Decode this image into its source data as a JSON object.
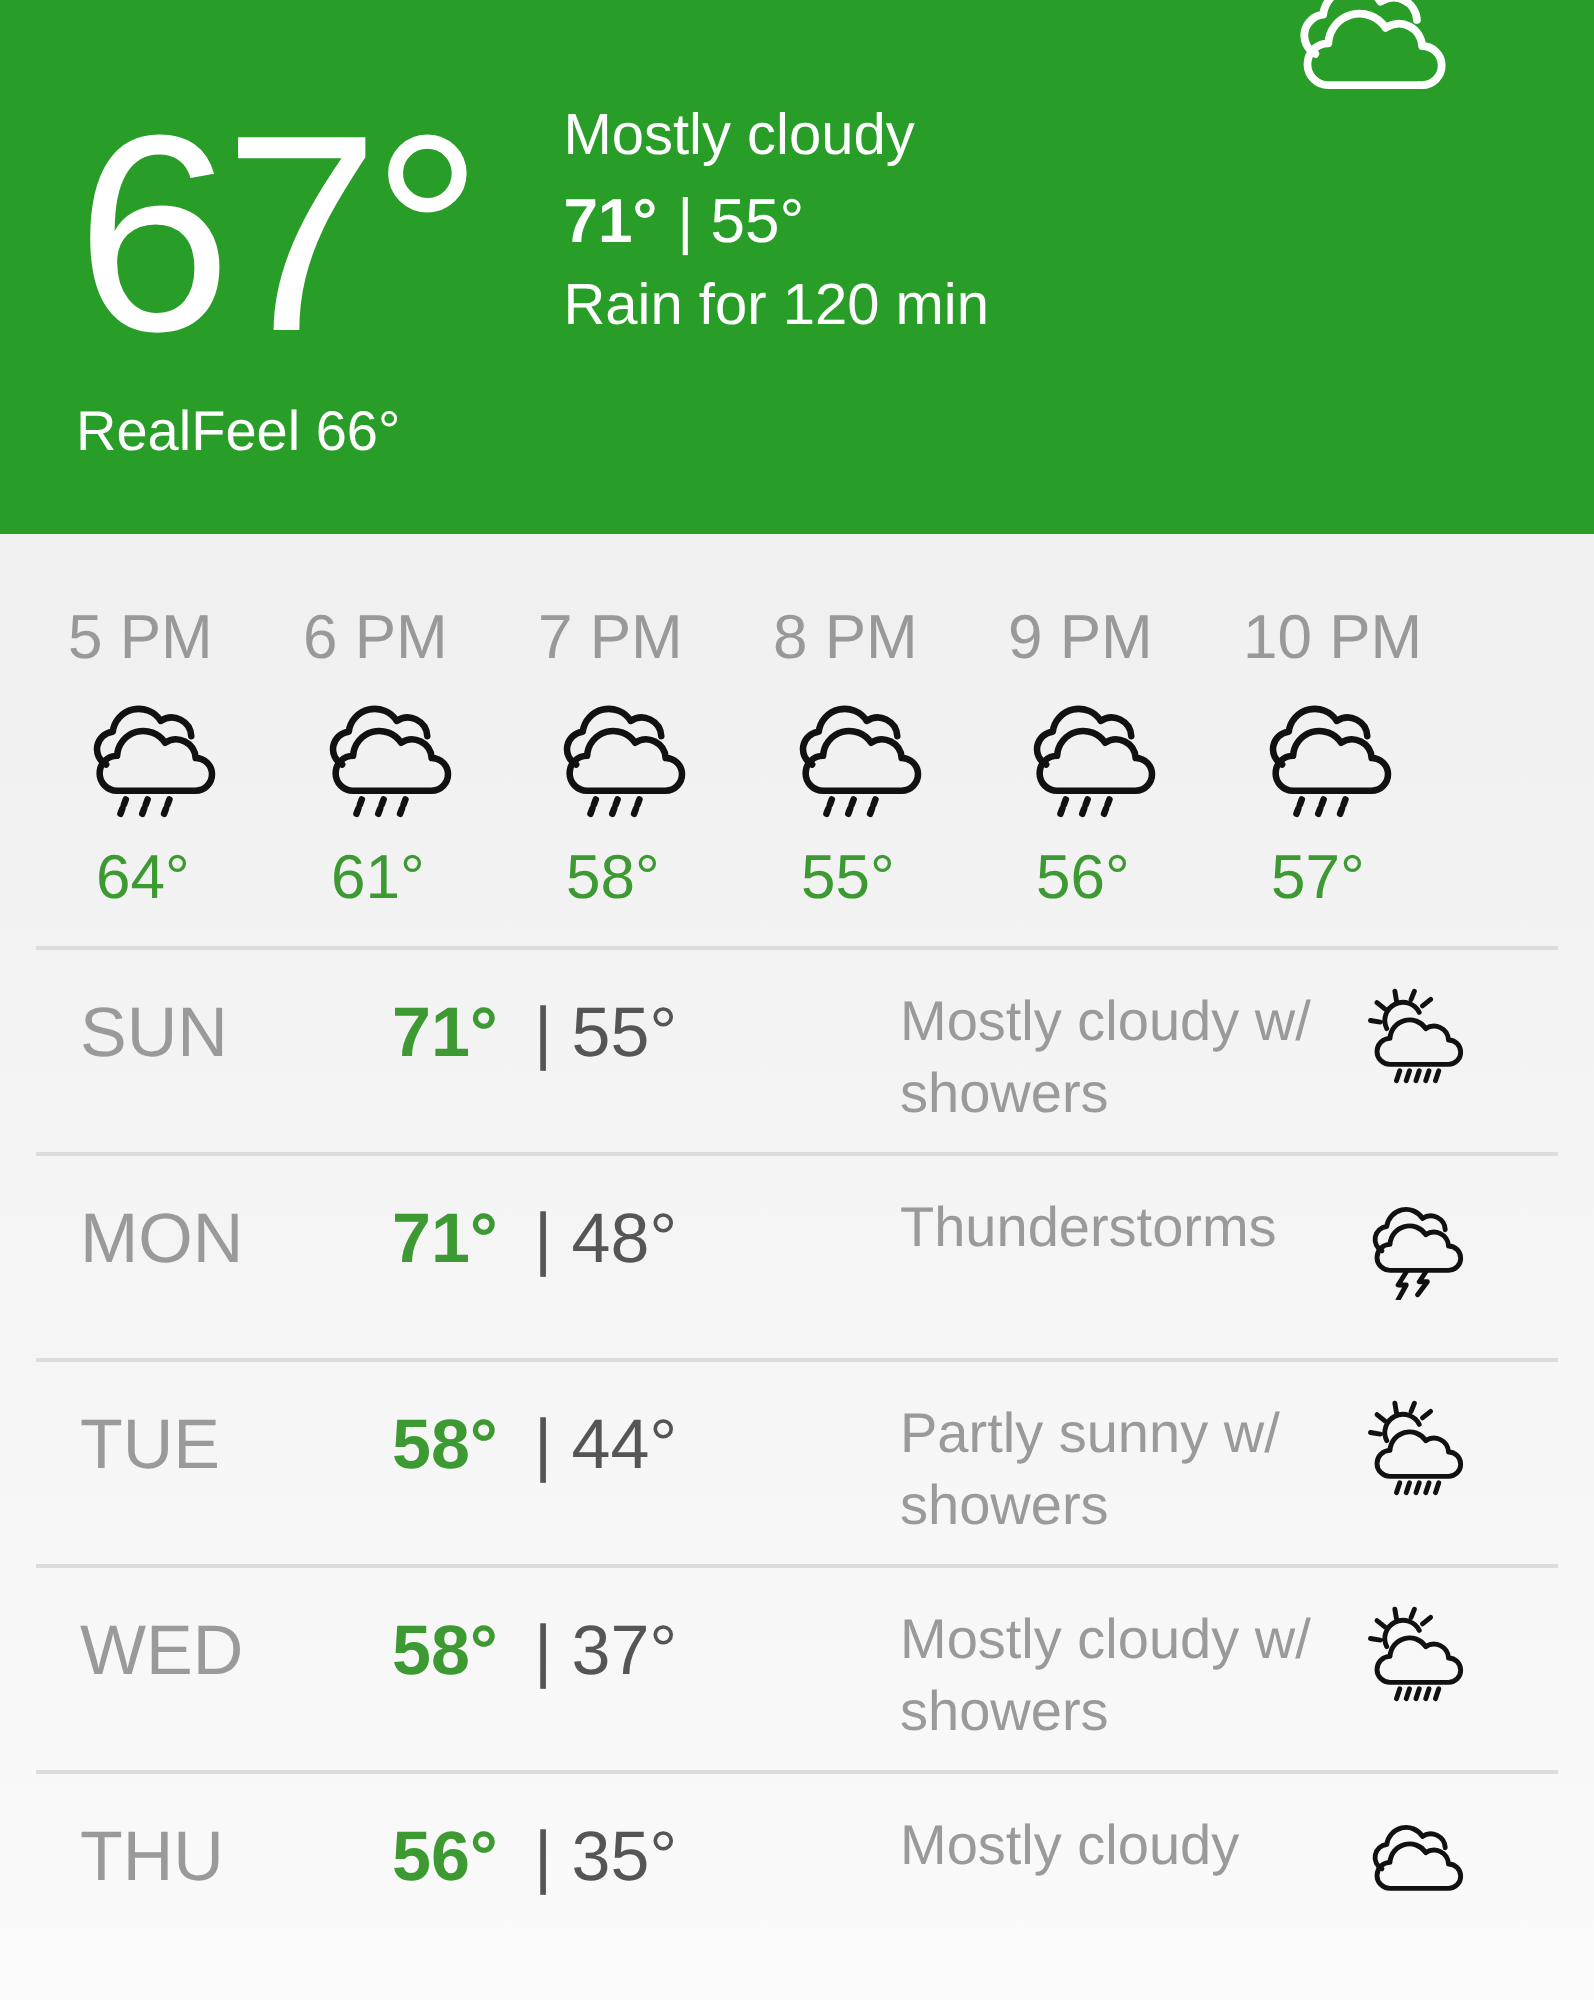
{
  "current": {
    "temperature": "67°",
    "condition": "Mostly cloudy",
    "high": "71°",
    "low": "| 55°",
    "note": "Rain for 120 min",
    "realfeel": "RealFeel 66°",
    "kind": "cloudy"
  },
  "hourly": [
    {
      "time": "5 PM",
      "kind": "rain",
      "temperature": "64°"
    },
    {
      "time": "6 PM",
      "kind": "rain",
      "temperature": "61°"
    },
    {
      "time": "7 PM",
      "kind": "rain",
      "temperature": "58°"
    },
    {
      "time": "8 PM",
      "kind": "rain",
      "temperature": "55°"
    },
    {
      "time": "9 PM",
      "kind": "rain",
      "temperature": "56°"
    },
    {
      "time": "10 PM",
      "kind": "rain",
      "temperature": "57°"
    }
  ],
  "daily": [
    {
      "day": "SUN",
      "high": "71°",
      "low": "| 55°",
      "condition": "Mostly cloudy w/ showers",
      "kind": "sun-showers"
    },
    {
      "day": "MON",
      "high": "71°",
      "low": "| 48°",
      "condition": "Thunderstorms",
      "kind": "thunder"
    },
    {
      "day": "TUE",
      "high": "58°",
      "low": "| 44°",
      "condition": "Partly sunny w/ showers",
      "kind": "sun-showers"
    },
    {
      "day": "WED",
      "high": "58°",
      "low": "| 37°",
      "condition": "Mostly cloudy w/ showers",
      "kind": "sun-showers"
    },
    {
      "day": "THU",
      "high": "56°",
      "low": "| 35°",
      "condition": "Mostly cloudy",
      "kind": "cloudy"
    }
  ]
}
